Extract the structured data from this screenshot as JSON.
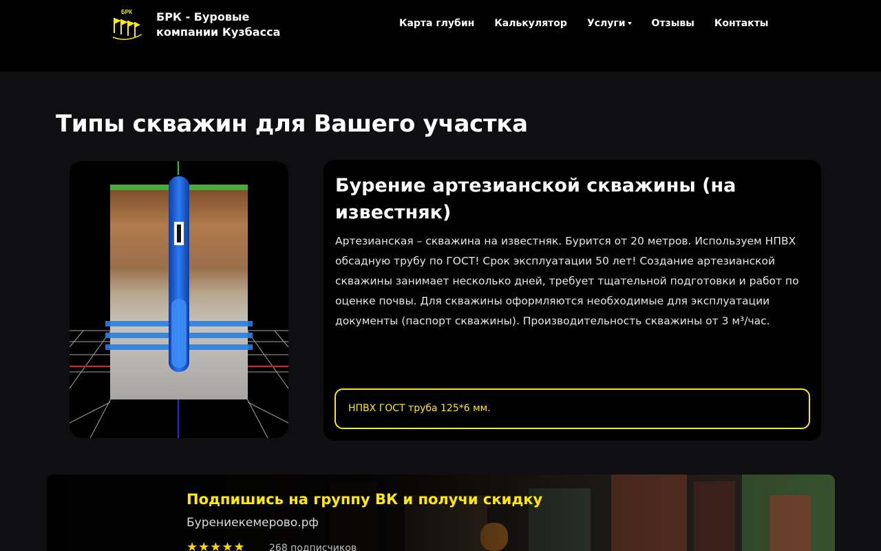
{
  "header": {
    "logo_text": "БРК",
    "brand": "БРК - Буровые компании Кузбасса",
    "nav": [
      {
        "label": "Карта глубин"
      },
      {
        "label": "Калькулятор"
      },
      {
        "label": "Услуги",
        "has_dropdown": true
      },
      {
        "label": "Отзывы"
      },
      {
        "label": "Контакты"
      }
    ]
  },
  "section": {
    "title": "Типы скважин для Вашего участка"
  },
  "card": {
    "title": "Бурение артезианской скважины (на известняк)",
    "text": "Артезианская – скважина на известняк. Бурится от 20 метров. Используем НПВХ обсадную трубу по ГОСТ! Срок эксплуатации 50 лет! Создание артезианской скважины занимает несколько дней, требует тщательной подготовки и работ по оценке почвы. Для скважины оформляются необходимые для эксплуатации документы (паспорт скважины). Производительность скважины от 3 м³/час.",
    "note": "НПВХ ГОСТ труба 125*6 мм."
  },
  "banner": {
    "title": "Подпишись на группу ВК и получи скидку",
    "site": "Бурениекемерово.рф",
    "stars": "★★★★★",
    "subscribers": "268 подписчиков"
  },
  "colors": {
    "accent": "#ffeb00",
    "background": "#0f0f12",
    "card": "#000000",
    "pipe": "#1e5fd6"
  },
  "icons": {
    "logo": "flags-logo-icon",
    "dropdown": "caret-down-icon",
    "star": "star-icon"
  }
}
